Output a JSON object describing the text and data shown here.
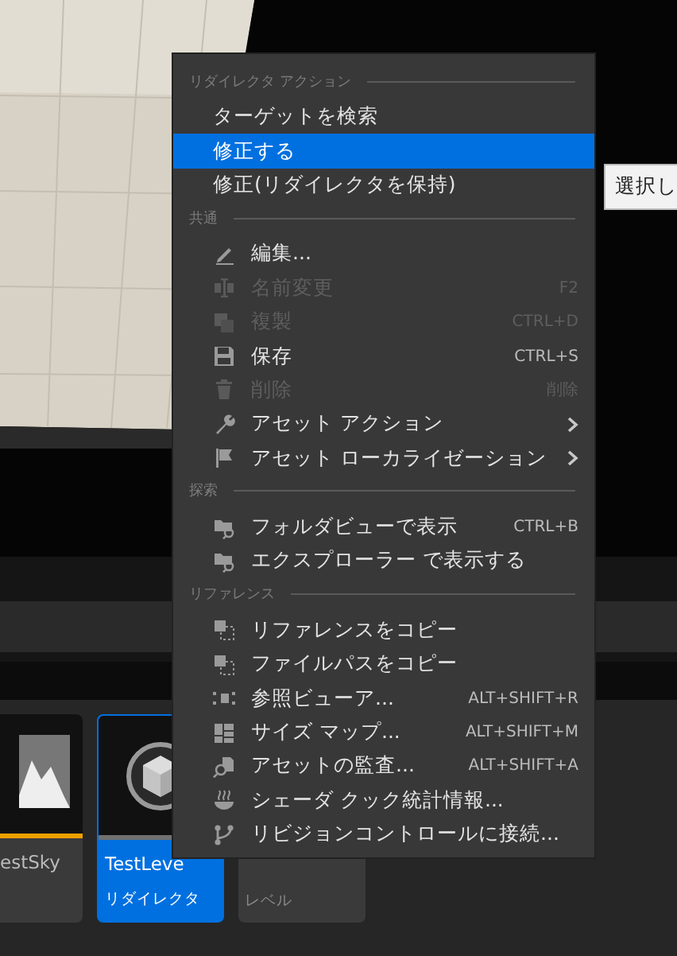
{
  "menu": {
    "sections": [
      {
        "header": "リダイレクタ アクション",
        "items": [
          {
            "label": "ターゲットを検索",
            "selected": false,
            "disabled": false
          },
          {
            "label": "修正する",
            "selected": true,
            "disabled": false
          },
          {
            "label": "修正(リダイレクタを保持)",
            "selected": false,
            "disabled": false
          }
        ]
      },
      {
        "header": "共通",
        "items": [
          {
            "label": "編集...",
            "selected": false,
            "disabled": false
          },
          {
            "label": "名前変更",
            "shortcut": "F2",
            "selected": false,
            "disabled": true
          },
          {
            "label": "複製",
            "shortcut": "CTRL+D",
            "selected": false,
            "disabled": true
          },
          {
            "label": "保存",
            "shortcut": "CTRL+S",
            "selected": false,
            "disabled": false
          },
          {
            "label": "削除",
            "shortcut": "削除",
            "selected": false,
            "disabled": true
          },
          {
            "label": "アセット アクション",
            "submenu": true,
            "selected": false,
            "disabled": false
          },
          {
            "label": "アセット ローカライゼーション",
            "submenu": true,
            "selected": false,
            "disabled": false
          }
        ]
      },
      {
        "header": "探索",
        "items": [
          {
            "label": "フォルダビューで表示",
            "shortcut": "CTRL+B",
            "selected": false,
            "disabled": false
          },
          {
            "label": "エクスプローラー で表示する",
            "selected": false,
            "disabled": false
          }
        ]
      },
      {
        "header": "リファレンス",
        "items": [
          {
            "label": "リファレンスをコピー",
            "selected": false,
            "disabled": false
          },
          {
            "label": "ファイルパスをコピー",
            "selected": false,
            "disabled": false
          },
          {
            "label": "参照ビューア...",
            "shortcut": "ALT+SHIFT+R",
            "selected": false,
            "disabled": false
          },
          {
            "label": "サイズ マップ...",
            "shortcut": "ALT+SHIFT+M",
            "selected": false,
            "disabled": false
          },
          {
            "label": "アセットの監査...",
            "shortcut": "ALT+SHIFT+A",
            "selected": false,
            "disabled": false
          },
          {
            "label": "シェーダ クック統計情報...",
            "selected": false,
            "disabled": false
          },
          {
            "label": "リビジョンコントロールに接続...",
            "selected": false,
            "disabled": false
          }
        ]
      }
    ]
  },
  "tooltip": {
    "text": "選択し"
  },
  "assets": [
    {
      "name": "estSky",
      "selected": false,
      "color": "#f0a000"
    },
    {
      "name": "TestLeve",
      "type": "リダイレクタ",
      "selected": true,
      "color": "#707070"
    },
    {
      "type": "レベル",
      "selected": false
    }
  ]
}
